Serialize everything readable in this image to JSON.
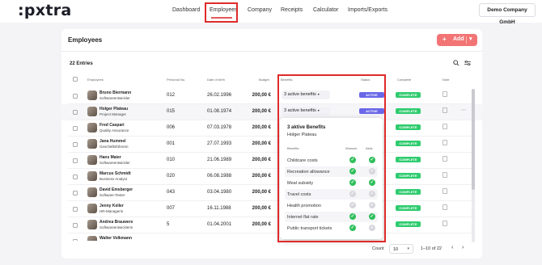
{
  "app": {
    "logo": ":pxtra",
    "company": "Demo Company GmbH",
    "nav": [
      {
        "label": "Dashboard"
      },
      {
        "label": "Employees"
      },
      {
        "label": "Company"
      },
      {
        "label": "Receipts"
      },
      {
        "label": "Calculator"
      },
      {
        "label": "Imports/Exports"
      }
    ]
  },
  "page": {
    "title": "Employees",
    "add_label": "Add",
    "entries": "22 Entries",
    "columns": {
      "employees": "Employees",
      "personal_no": "Personal No.",
      "dob": "Date of birth",
      "budget": "Budget",
      "benefits": "Benefits",
      "status": "Status",
      "complete": "Complete",
      "note": "Note"
    }
  },
  "rows": [
    {
      "name": "Bruno Biermann",
      "role": "Softwareentwickler",
      "pno": "012",
      "dob": "26.02.1996",
      "budget": "200,00 €",
      "benefits": "3 active benefits",
      "status": "ACTIVE",
      "complete": "COMPLETE"
    },
    {
      "name": "Holger Plateau",
      "role": "Project Manager",
      "pno": "015",
      "dob": "01.08.1974",
      "budget": "200,00 €",
      "benefits": "3 active benefits",
      "status": "ACTIVE",
      "complete": "COMPLETE"
    },
    {
      "name": "Fred Caspari",
      "role": "Quality Assurance",
      "pno": "006",
      "dob": "07.03.1978",
      "budget": "200,00 €",
      "complete": "COMPLETE"
    },
    {
      "name": "Jana Hummel",
      "role": "Geschäftsführerin",
      "pno": "001",
      "dob": "27.07.1993",
      "budget": "200,00 €",
      "complete": "COMPLETE"
    },
    {
      "name": "Hans Maier",
      "role": "Softwareentwickler",
      "pno": "010",
      "dob": "21.06.1989",
      "budget": "200,00 €",
      "complete": "COMPLETE"
    },
    {
      "name": "Marcus Schmidt",
      "role": "Business Analyst",
      "pno": "020",
      "dob": "06.08.1988",
      "budget": "200,00 €",
      "complete": "COMPLETE"
    },
    {
      "name": "David Emsberger",
      "role": "Software-Tester",
      "pno": "043",
      "dob": "03.04.1980",
      "budget": "200,00 €",
      "complete": "COMPLETE"
    },
    {
      "name": "Jenny Keller",
      "role": "HR-Managerin",
      "pno": "007",
      "dob": "16.11.1988",
      "budget": "200,00 €",
      "complete": "COMPLETE"
    },
    {
      "name": "Andrea Brauwers",
      "role": "Softwareentwicklerin",
      "pno": "5",
      "dob": "01.04.2001",
      "budget": "200,00 €",
      "complete": "COMPLETE"
    },
    {
      "name": "Walter Volkmann",
      "role": "",
      "pno": "",
      "dob": "",
      "budget": "",
      "complete": ""
    }
  ],
  "popover": {
    "title": "3 aktive Benefits",
    "subtitle": "Holger Plateau",
    "col_benefits": "Benefits",
    "col_wunsch": "Wunsch",
    "col_aktiv": "Aktiv",
    "items": [
      {
        "label": "Childcare costs",
        "wunsch": true,
        "aktiv": true
      },
      {
        "label": "Recreation allowance",
        "wunsch": true,
        "aktiv": false
      },
      {
        "label": "Meal subsidy",
        "wunsch": true,
        "aktiv": true
      },
      {
        "label": "Travel costs",
        "wunsch": false,
        "aktiv": false
      },
      {
        "label": "Health promotion",
        "wunsch": false,
        "aktiv": false
      },
      {
        "label": "Internet flat rate",
        "wunsch": true,
        "aktiv": true
      },
      {
        "label": "Public transport tickets",
        "wunsch": true,
        "aktiv": false
      }
    ]
  },
  "footer": {
    "count_label": "Count",
    "count_value": "10",
    "range": "1–10 of 22"
  },
  "colors": {
    "accent": "#f27474",
    "status_active": "#6a67e8",
    "complete": "#2fcc6f"
  }
}
